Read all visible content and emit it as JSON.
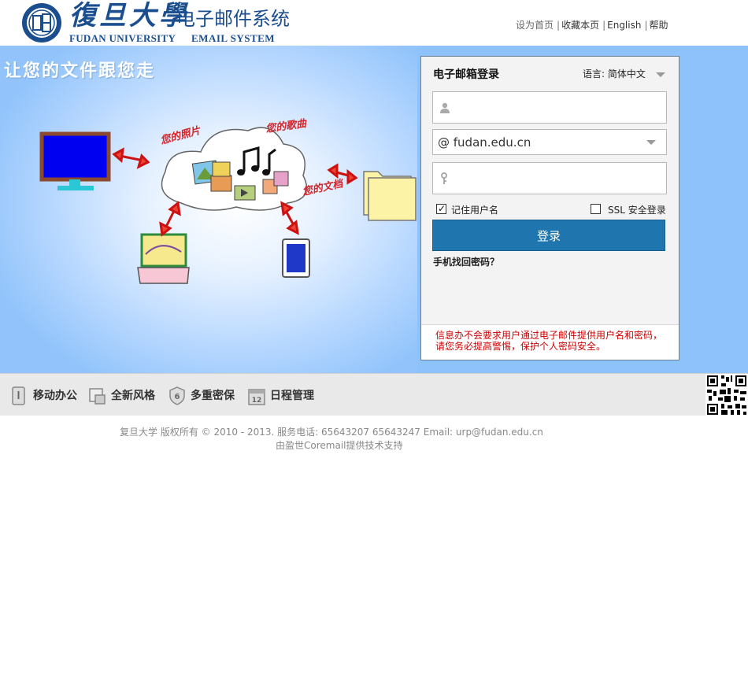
{
  "header": {
    "university_cn": "復旦大學",
    "university_en": "FUDAN UNIVERSITY",
    "system_cn": "电子邮件系统",
    "system_en": "EMAIL SYSTEM",
    "links": [
      "设为首页",
      "收藏本页",
      "English",
      "帮助"
    ]
  },
  "banner": {
    "slogan": "让您的文件跟您走",
    "captions": [
      "您的照片",
      "您的歌曲",
      "您的文档"
    ]
  },
  "login": {
    "title": "电子邮箱登录",
    "language_label": "语言:",
    "language_value": "简体中文",
    "username_value": "",
    "domain_value": "@ fudan.edu.cn",
    "password_value": "",
    "remember_label": "记住用户名",
    "remember_checked": true,
    "ssl_label": "SSL 安全登录",
    "ssl_checked": false,
    "submit_label": "登录",
    "forgot_label": "手机找回密码？",
    "notice_line1": "信息办不会要求用户通过电子邮件提供用户名和密码，",
    "notice_line2": "请您务必提高警惕，保护个人密码安全。"
  },
  "features": [
    {
      "label": "移动办公",
      "icon": "mobile-icon"
    },
    {
      "label": "全新风格",
      "icon": "ui-style-icon"
    },
    {
      "label": "多重密保",
      "icon": "shield-icon"
    },
    {
      "label": "日程管理",
      "icon": "calendar-icon"
    }
  ],
  "calendar_day": "12",
  "shield_number": "6",
  "footer": {
    "line1": "复旦大学  版权所有  © 2010 - 2013. 服务电话: 65643207 65643247 Email: urp@fudan.edu.cn",
    "line2": "由盈世Coremail提供技术支持"
  },
  "colors": {
    "brand_blue": "#1a4e8f",
    "button_blue": "#1f75ae",
    "notice_red": "#cc0000",
    "banner_blue": "#8ec2fa"
  }
}
